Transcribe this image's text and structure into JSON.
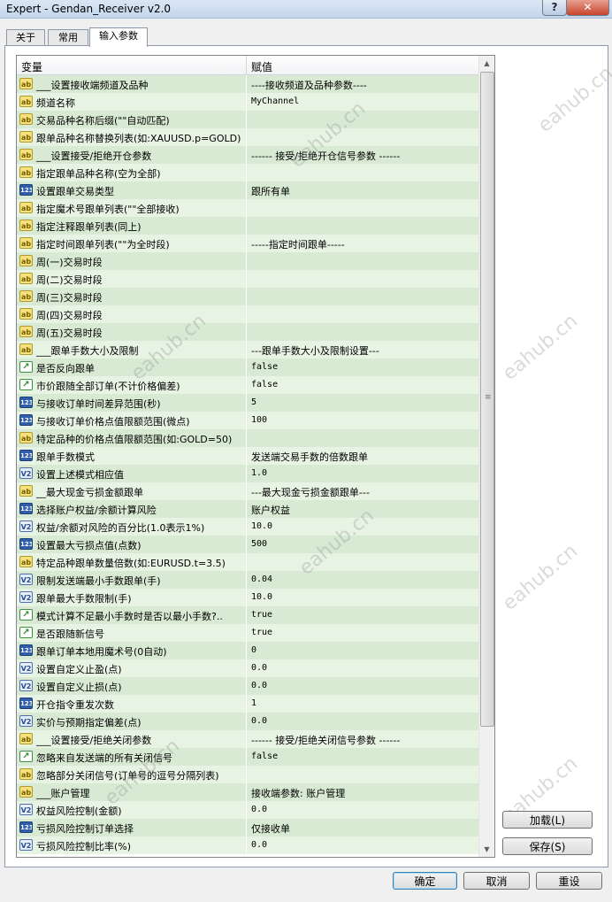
{
  "window": {
    "title": "Expert - Gendan_Receiver v2.0",
    "help_glyph": "?",
    "close_glyph": "✕"
  },
  "tabs": [
    {
      "label": "关于"
    },
    {
      "label": "常用"
    },
    {
      "label": "输入参数",
      "active": true
    }
  ],
  "grid": {
    "col_variable": "变量",
    "col_value": "赋值",
    "rows": [
      {
        "type": "str",
        "name": "___设置接收端频道及品种",
        "value": "----接收频道及品种参数----",
        "mono": false
      },
      {
        "type": "str",
        "name": "频道名称",
        "value": "MyChannel",
        "mono": true
      },
      {
        "type": "str",
        "name": "交易品种名称后缀(\"\"自动匹配)",
        "value": "",
        "mono": false
      },
      {
        "type": "str",
        "name": "跟单品种名称替换列表(如:XAUUSD.p=GOLD)",
        "value": "",
        "mono": false
      },
      {
        "type": "str",
        "name": "___设置接受/拒绝开仓参数",
        "value": "------ 接受/拒绝开仓信号参数 ------",
        "mono": false
      },
      {
        "type": "str",
        "name": "指定跟单品种名称(空为全部)",
        "value": "",
        "mono": false
      },
      {
        "type": "int",
        "name": "设置跟单交易类型",
        "value": "跟所有单",
        "mono": false
      },
      {
        "type": "str",
        "name": "指定魔术号跟单列表(\"\"全部接收)",
        "value": "",
        "mono": false
      },
      {
        "type": "str",
        "name": "指定注释跟单列表(同上)",
        "value": "",
        "mono": false
      },
      {
        "type": "str",
        "name": "指定时间跟单列表(\"\"为全时段)",
        "value": "-----指定时间跟单-----",
        "mono": false
      },
      {
        "type": "str",
        "name": "周(一)交易时段",
        "value": "",
        "mono": false
      },
      {
        "type": "str",
        "name": "周(二)交易时段",
        "value": "",
        "mono": false
      },
      {
        "type": "str",
        "name": "周(三)交易时段",
        "value": "",
        "mono": false
      },
      {
        "type": "str",
        "name": "周(四)交易时段",
        "value": "",
        "mono": false
      },
      {
        "type": "str",
        "name": "周(五)交易时段",
        "value": "",
        "mono": false
      },
      {
        "type": "str",
        "name": "___跟单手数大小及限制",
        "value": "---跟单手数大小及限制设置---",
        "mono": false
      },
      {
        "type": "bool",
        "name": "是否反向跟单",
        "value": "false",
        "mono": true
      },
      {
        "type": "bool",
        "name": "市价跟随全部订单(不计价格偏差)",
        "value": "false",
        "mono": true
      },
      {
        "type": "int",
        "name": "与接收订单时间差异范围(秒)",
        "value": "5",
        "mono": true
      },
      {
        "type": "int",
        "name": "与接收订单价格点值限额范围(微点)",
        "value": "100",
        "mono": true
      },
      {
        "type": "str",
        "name": "特定品种的价格点值限额范围(如:GOLD=50)",
        "value": "",
        "mono": false
      },
      {
        "type": "int",
        "name": "跟单手数模式",
        "value": "发送端交易手数的倍数跟单",
        "mono": false
      },
      {
        "type": "dbl",
        "name": "设置上述模式相应值",
        "value": "1.0",
        "mono": true
      },
      {
        "type": "str",
        "name": "__最大现金亏损金额跟单",
        "value": "---最大现金亏损金额跟单---",
        "mono": false
      },
      {
        "type": "int",
        "name": "选择账户权益/余额计算风险",
        "value": "账户权益",
        "mono": false
      },
      {
        "type": "dbl",
        "name": "权益/余额对风险的百分比(1.0表示1%)",
        "value": "10.0",
        "mono": true
      },
      {
        "type": "int",
        "name": "设置最大亏损点值(点数)",
        "value": "500",
        "mono": true
      },
      {
        "type": "str",
        "name": "特定品种跟单数量倍数(如:EURUSD.t=3.5)",
        "value": "",
        "mono": false
      },
      {
        "type": "dbl",
        "name": "限制发送端最小手数跟单(手)",
        "value": "0.04",
        "mono": true
      },
      {
        "type": "dbl",
        "name": "跟单最大手数限制(手)",
        "value": "10.0",
        "mono": true
      },
      {
        "type": "bool",
        "name": "模式计算不足最小手数时是否以最小手数?..",
        "value": "true",
        "mono": true
      },
      {
        "type": "bool",
        "name": "是否跟随新信号",
        "value": "true",
        "mono": true
      },
      {
        "type": "int",
        "name": "跟单订单本地用魔术号(0自动)",
        "value": "0",
        "mono": true
      },
      {
        "type": "dbl",
        "name": "设置自定义止盈(点)",
        "value": "0.0",
        "mono": true
      },
      {
        "type": "dbl",
        "name": "设置自定义止损(点)",
        "value": "0.0",
        "mono": true
      },
      {
        "type": "int",
        "name": "开仓指令重发次数",
        "value": "1",
        "mono": true
      },
      {
        "type": "dbl",
        "name": "实价与预期指定偏差(点)",
        "value": "0.0",
        "mono": true
      },
      {
        "type": "str",
        "name": "___设置接受/拒绝关闭参数",
        "value": "------ 接受/拒绝关闭信号参数 ------",
        "mono": false
      },
      {
        "type": "bool",
        "name": "忽略来自发送端的所有关闭信号",
        "value": "false",
        "mono": true
      },
      {
        "type": "str",
        "name": "忽略部分关闭信号(订单号的逗号分隔列表)",
        "value": "",
        "mono": false
      },
      {
        "type": "str",
        "name": "___账户管理",
        "value": "接收端参数: 账户管理",
        "mono": false
      },
      {
        "type": "dbl",
        "name": "权益风险控制(金额)",
        "value": "0.0",
        "mono": true
      },
      {
        "type": "int",
        "name": "亏损风险控制订单选择",
        "value": "仅接收单",
        "mono": false
      },
      {
        "type": "dbl",
        "name": "亏损风险控制比率(%)",
        "value": "0.0",
        "mono": true
      }
    ]
  },
  "icon_text": {
    "str": "ab",
    "int": "123",
    "dbl": "V2",
    "bool": "↗"
  },
  "buttons": {
    "load": "加载(L)",
    "save": "保存(S)",
    "ok": "确定",
    "cancel": "取消",
    "reset": "重设"
  },
  "watermark": "eahub.cn",
  "scrollbar": {
    "up_glyph": "▲",
    "down_glyph": "▼",
    "grip_glyph": "≡"
  }
}
